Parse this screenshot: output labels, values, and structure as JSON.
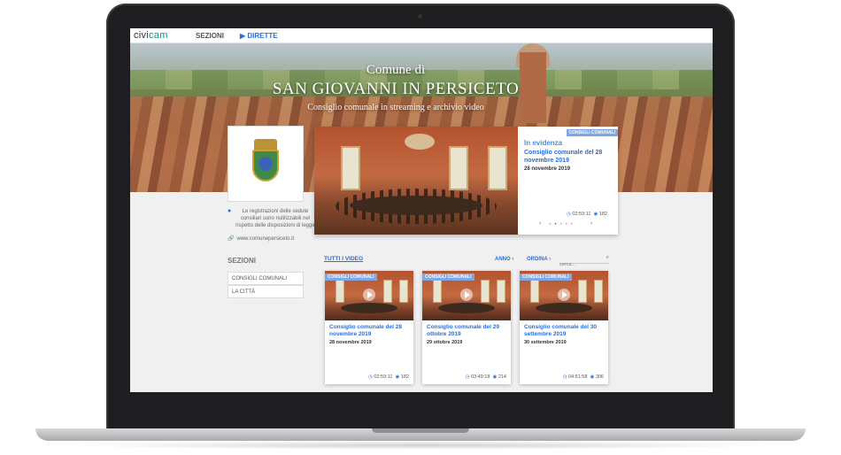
{
  "nav": {
    "logo_text": "civi",
    "logo_accent": "cam",
    "sezioni": "SEZIONI",
    "dirette": "▶ DIRETTE"
  },
  "hero": {
    "line1": "Comune di",
    "line2": "SAN GIOVANNI IN PERSICETO",
    "line3": "Consiglio comunale in streaming e archivio video"
  },
  "sidebar": {
    "info": "Le registrazioni delle sedute consiliari sono riutilizzabili nel rispetto delle disposizioni di legge",
    "link": "www.comunepersiceto.it",
    "sections_title": "SEZIONI",
    "items": [
      {
        "label": "CONSIGLI COMUNALI"
      },
      {
        "label": "LA CITTÀ"
      }
    ]
  },
  "featured": {
    "badge": "CONSIGLI COMUNALI",
    "label": "In evidenza",
    "title": "Consiglio comunale del 28 novembre 2019",
    "date": "28 novembre 2019",
    "duration": "02:59:11",
    "views": "182"
  },
  "filters": {
    "all_videos": "TUTTI I VIDEO",
    "anno": "ANNO",
    "ordina": "ORDINA",
    "search_placeholder": "cerca..."
  },
  "videos": [
    {
      "badge": "CONSIGLI COMUNALI",
      "title": "Consiglio comunale del 28 novembre 2019",
      "date": "28 novembre 2019",
      "duration": "02:59:11",
      "views": "182"
    },
    {
      "badge": "CONSIGLI COMUNALI",
      "title": "Consiglio comunale del 29 ottobre 2019",
      "date": "29 ottobre 2019",
      "duration": "03:49:18",
      "views": "214"
    },
    {
      "badge": "CONSIGLI COMUNALI",
      "title": "Consiglio comunale del 30 settembre 2019",
      "date": "30 settembre 2019",
      "duration": "04:51:58",
      "views": "306"
    }
  ],
  "colors": {
    "accent": "#2a6fd6",
    "badge": "#7fa7e3",
    "logo_accent": "#0f8f8a"
  }
}
